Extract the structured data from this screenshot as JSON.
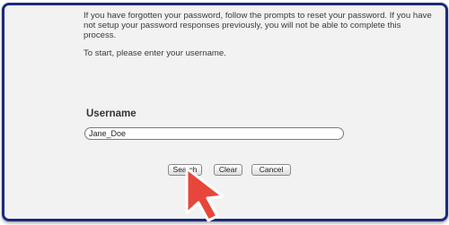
{
  "instructions": {
    "paragraph1": "If you have forgotten your password, follow the prompts to reset your password. If you have not setup your password responses previously, you will not be able to complete this process.",
    "paragraph2": "To start, please enter your username."
  },
  "form": {
    "username_label": "Username",
    "username_value": "Jane_Doe"
  },
  "buttons": {
    "search": "Search",
    "clear": "Clear",
    "cancel": "Cancel"
  },
  "colors": {
    "frame_border": "#1c2a7a",
    "cursor_fill": "#e8463a",
    "panel_background": "#f2f2f2"
  },
  "icons": {
    "cursor": "arrow-pointer-icon"
  }
}
